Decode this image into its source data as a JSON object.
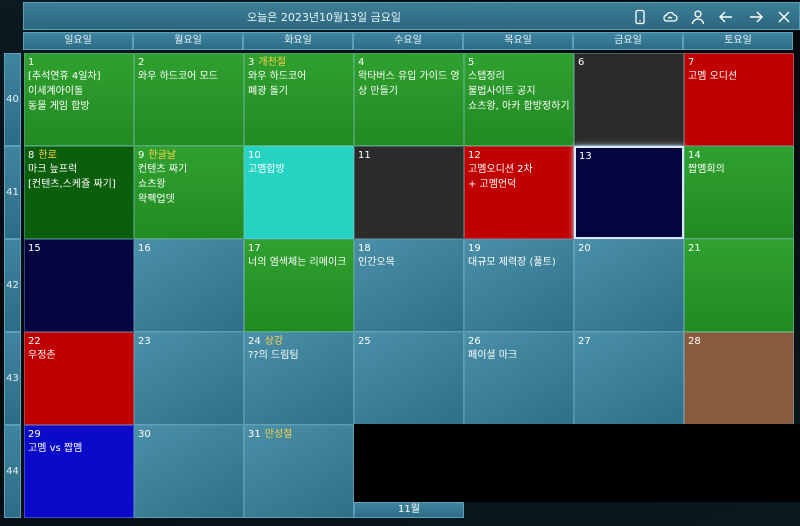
{
  "title": "오늘은 2023년10월13일 금요일",
  "toolbar_icons": [
    "phone-icon",
    "cloud-sync-icon",
    "user-icon",
    "arrow-left-icon",
    "arrow-right-icon",
    "close-icon"
  ],
  "weekdays": [
    "일요일",
    "월요일",
    "화요일",
    "수요일",
    "목요일",
    "금요일",
    "토요일"
  ],
  "weeks": [
    "40",
    "41",
    "42",
    "43",
    "44"
  ],
  "days": [
    {
      "day": "1",
      "holiday": "",
      "color": "green",
      "events": [
        "[추석연휴 4일차]",
        "이세계아이돌",
        "동물 게임 합방"
      ]
    },
    {
      "day": "2",
      "holiday": "",
      "color": "green",
      "events": [
        "와우 하드코어 모드"
      ]
    },
    {
      "day": "3",
      "holiday": "개천절",
      "color": "green",
      "events": [
        "와우 하드코어",
        "폐광 돌기"
      ]
    },
    {
      "day": "4",
      "holiday": "",
      "color": "green",
      "events": [
        "왁타버스 유입 가이드 영",
        "상 만들기"
      ]
    },
    {
      "day": "5",
      "holiday": "",
      "color": "green",
      "events": [
        "스텝정리",
        "불법사이트 공지",
        "쇼츠왕, 아카 합방정하기"
      ]
    },
    {
      "day": "6",
      "holiday": "",
      "color": "dark",
      "events": []
    },
    {
      "day": "7",
      "holiday": "",
      "color": "red",
      "events": [
        "고멤 오디션"
      ]
    },
    {
      "day": "8",
      "holiday": "한로",
      "color": "dgreen",
      "events": [
        "마크 늪프럭",
        "[컨텐츠,스케쥴 짜기]"
      ]
    },
    {
      "day": "9",
      "holiday": "한글날",
      "color": "green",
      "events": [
        "컨텐츠 짜기",
        "쇼츠왕",
        "왁펙업뎃"
      ]
    },
    {
      "day": "10",
      "holiday": "",
      "color": "cyan",
      "events": [
        "고멤합방"
      ]
    },
    {
      "day": "11",
      "holiday": "",
      "color": "dark",
      "events": []
    },
    {
      "day": "12",
      "holiday": "",
      "color": "red",
      "events": [
        "고멤오디션 2차",
        "+ 고멤언덕"
      ]
    },
    {
      "day": "13",
      "holiday": "",
      "color": "navy",
      "events": []
    },
    {
      "day": "14",
      "holiday": "",
      "color": "green",
      "events": [
        "짭멤회의"
      ]
    },
    {
      "day": "15",
      "holiday": "",
      "color": "navy",
      "events": []
    },
    {
      "day": "16",
      "holiday": "",
      "color": "teal",
      "events": []
    },
    {
      "day": "17",
      "holiday": "",
      "color": "green",
      "events": [
        "너의 염색체는 리메이크"
      ]
    },
    {
      "day": "18",
      "holiday": "",
      "color": "teal",
      "events": [
        "인간오목"
      ]
    },
    {
      "day": "19",
      "holiday": "",
      "color": "teal",
      "events": [
        "대규모 제력장 (풀트)"
      ]
    },
    {
      "day": "20",
      "holiday": "",
      "color": "teal",
      "events": []
    },
    {
      "day": "21",
      "holiday": "",
      "color": "green",
      "events": []
    },
    {
      "day": "22",
      "holiday": "",
      "color": "red",
      "events": [
        "우정촌"
      ]
    },
    {
      "day": "23",
      "holiday": "",
      "color": "teal",
      "events": []
    },
    {
      "day": "24",
      "holiday": "상강",
      "color": "teal",
      "events": [
        "??의 드림팀"
      ]
    },
    {
      "day": "25",
      "holiday": "",
      "color": "teal",
      "events": []
    },
    {
      "day": "26",
      "holiday": "",
      "color": "teal",
      "events": [
        "페이셜 마크"
      ]
    },
    {
      "day": "27",
      "holiday": "",
      "color": "teal",
      "events": []
    },
    {
      "day": "28",
      "holiday": "",
      "color": "brown",
      "events": []
    },
    {
      "day": "29",
      "holiday": "",
      "color": "blue",
      "events": [
        "고멤 vs 짭멤"
      ]
    },
    {
      "day": "30",
      "holiday": "",
      "color": "teal",
      "events": []
    },
    {
      "day": "31",
      "holiday": "만성절",
      "color": "teal",
      "events": []
    }
  ],
  "selected_day": "13",
  "next_month_label": "11월",
  "colors": {
    "green": "#2fa12f",
    "teal": "#3a7f98",
    "dark": "#2b2b2b",
    "red": "#c00000",
    "navy": "#050540",
    "dgreen": "#0b5e0b",
    "cyan": "#26d3c3",
    "blue": "#0a0ac8",
    "brown": "#8a5a3e",
    "holiday_text": "#ffd24a"
  }
}
